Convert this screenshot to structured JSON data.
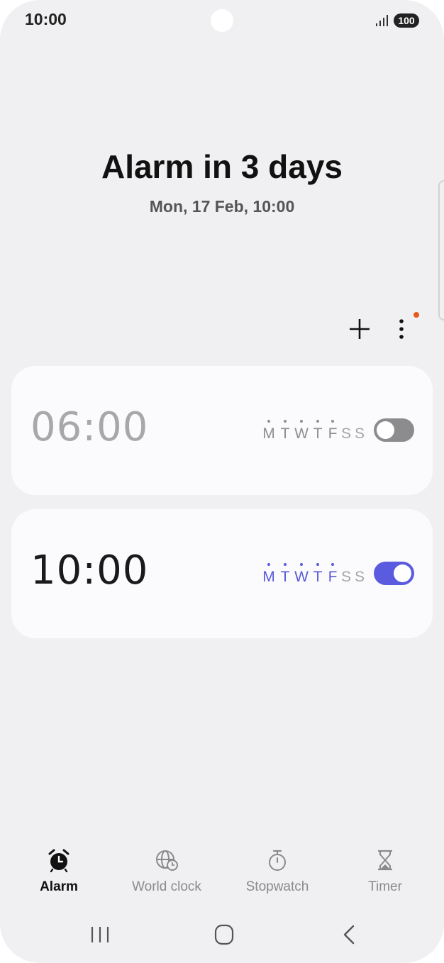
{
  "status_bar": {
    "time": "10:00",
    "battery": "100"
  },
  "header": {
    "title": "Alarm in 3 days",
    "subtitle": "Mon, 17 Feb, 10:00"
  },
  "toolbar": {
    "add_icon": "plus-icon",
    "more_icon": "more-vertical-icon",
    "has_notification_dot": true
  },
  "alarms": [
    {
      "time": "06:00",
      "enabled": false,
      "days": [
        {
          "label": "M",
          "active": true
        },
        {
          "label": "T",
          "active": true
        },
        {
          "label": "W",
          "active": true
        },
        {
          "label": "T",
          "active": true
        },
        {
          "label": "F",
          "active": true
        },
        {
          "label": "S",
          "active": false
        },
        {
          "label": "S",
          "active": false
        }
      ]
    },
    {
      "time": "10:00",
      "enabled": true,
      "days": [
        {
          "label": "M",
          "active": true
        },
        {
          "label": "T",
          "active": true
        },
        {
          "label": "W",
          "active": true
        },
        {
          "label": "T",
          "active": true
        },
        {
          "label": "F",
          "active": true
        },
        {
          "label": "S",
          "active": false
        },
        {
          "label": "S",
          "active": false
        }
      ]
    }
  ],
  "bottom_nav": [
    {
      "label": "Alarm",
      "icon": "alarm-clock-icon",
      "active": true
    },
    {
      "label": "World clock",
      "icon": "globe-clock-icon",
      "active": false
    },
    {
      "label": "Stopwatch",
      "icon": "stopwatch-icon",
      "active": false
    },
    {
      "label": "Timer",
      "icon": "hourglass-icon",
      "active": false
    }
  ],
  "system_nav": [
    "recents-icon",
    "home-icon",
    "back-icon"
  ],
  "colors": {
    "accent": "#5b5bdf",
    "notification": "#e8591e",
    "background": "#f0f0f2",
    "card": "#fbfbfd"
  }
}
